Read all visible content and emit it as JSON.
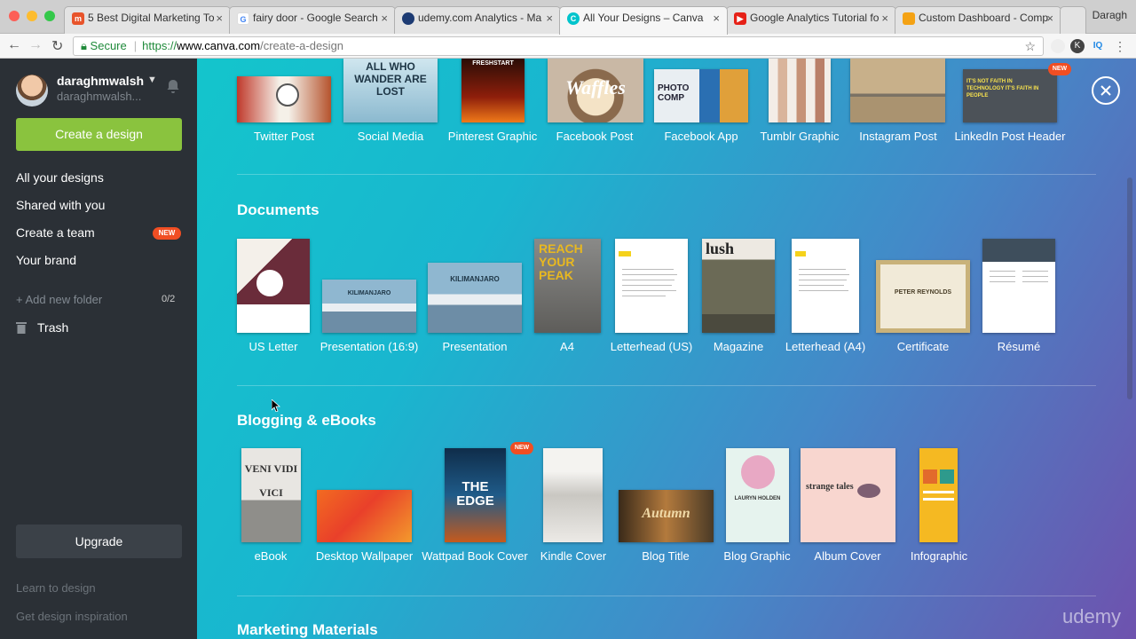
{
  "browser": {
    "tabs": [
      {
        "title": "5 Best Digital Marketing To",
        "icon": "m-favicon",
        "color": "#e8542b"
      },
      {
        "title": "fairy door - Google Search",
        "icon": "google-favicon",
        "color": "#4285f4"
      },
      {
        "title": "udemy.com Analytics - Ma",
        "icon": "analytics-favicon",
        "color": "#f4a214"
      },
      {
        "title": "All Your Designs – Canva",
        "icon": "canva-favicon",
        "color": "#00c4cc"
      },
      {
        "title": "Google Analytics Tutorial fo",
        "icon": "youtube-favicon",
        "color": "#e62117"
      },
      {
        "title": "Custom Dashboard - Comp",
        "icon": "analytics-favicon",
        "color": "#f4a214"
      }
    ],
    "profile_name": "Daragh",
    "secure_label": "Secure",
    "url_scheme": "https://",
    "url_host": "www.canva.com",
    "url_path": "/create-a-design"
  },
  "sidebar": {
    "username": "daraghmwalsh",
    "subname": "daraghmwalsh...",
    "create_label": "Create a design",
    "items": [
      {
        "label": "All your designs"
      },
      {
        "label": "Shared with you"
      },
      {
        "label": "Create a team"
      },
      {
        "label": "Your brand"
      }
    ],
    "new_badge": "NEW",
    "add_folder": "+ Add new folder",
    "folder_count": "0/2",
    "trash_label": "Trash",
    "upgrade_label": "Upgrade",
    "learn_label": "Learn to design",
    "inspire_label": "Get design inspiration"
  },
  "main": {
    "social": [
      {
        "label": "Twitter Post"
      },
      {
        "label": "Social Media",
        "thumb_text": "ALL WHO WANDER ARE LOST"
      },
      {
        "label": "Pinterest Graphic",
        "thumb_text": "FRESHSTART"
      },
      {
        "label": "Facebook Post",
        "thumb_text": "Waffles"
      },
      {
        "label": "Facebook App",
        "thumb_text": "PHOTO COMP"
      },
      {
        "label": "Tumblr Graphic"
      },
      {
        "label": "Instagram Post"
      },
      {
        "label": "LinkedIn Post Header",
        "thumb_text": "IT'S NOT FAITH IN TECHNOLOGY IT'S FAITH IN PEOPLE"
      }
    ],
    "social_new_badge": "NEW",
    "documents_title": "Documents",
    "documents": [
      {
        "label": "US Letter"
      },
      {
        "label": "Presentation (16:9)",
        "thumb_text": "KILIMANJARO"
      },
      {
        "label": "Presentation",
        "thumb_text": "KILIMANJARO"
      },
      {
        "label": "A4",
        "thumb_text": "REACH YOUR PEAK"
      },
      {
        "label": "Letterhead (US)"
      },
      {
        "label": "Magazine",
        "thumb_text": "lush"
      },
      {
        "label": "Letterhead (A4)"
      },
      {
        "label": "Certificate",
        "thumb_text": "PETER REYNOLDS"
      },
      {
        "label": "Résumé"
      }
    ],
    "blogging_title": "Blogging & eBooks",
    "blogging": [
      {
        "label": "eBook",
        "thumb_text": "VENI VIDI VICI"
      },
      {
        "label": "Desktop Wallpaper"
      },
      {
        "label": "Wattpad Book Cover",
        "thumb_text": "THE EDGE"
      },
      {
        "label": "Kindle Cover"
      },
      {
        "label": "Blog Title",
        "thumb_text": "Autumn"
      },
      {
        "label": "Blog Graphic",
        "thumb_text": "LAURYN HOLDEN"
      },
      {
        "label": "Album Cover",
        "thumb_text": "strange tales"
      },
      {
        "label": "Infographic"
      }
    ],
    "blogging_new_badge": "NEW",
    "marketing_title": "Marketing Materials",
    "watermark": "udemy"
  },
  "colors": {
    "accent_green": "#8ac33e",
    "badge_red": "#f04e23",
    "sidebar_bg": "#2b3036"
  }
}
